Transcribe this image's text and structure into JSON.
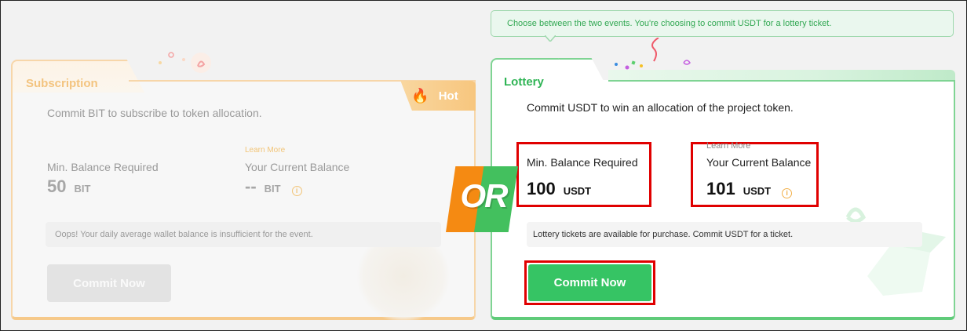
{
  "subscription": {
    "title": "Subscription",
    "badge": "Hot",
    "description": "Commit BIT to subscribe to token allocation.",
    "min_balance_label": "Min. Balance Required",
    "min_balance_value": "50",
    "min_balance_unit": "BIT",
    "learn_more": "Learn More",
    "current_balance_label": "Your Current Balance",
    "current_balance_value": "--",
    "current_balance_unit": "BIT",
    "warning": "Oops! Your daily average wallet balance is insufficient for the event.",
    "commit_label": "Commit Now"
  },
  "or_label": "OR",
  "lottery": {
    "tooltip": "Choose between the two events. You're choosing to commit USDT for a lottery ticket.",
    "title": "Lottery",
    "description": "Commit USDT to win an allocation of the project token.",
    "min_balance_label": "Min. Balance Required",
    "min_balance_value": "100",
    "min_balance_unit": "USDT",
    "learn_more": "Learn More",
    "current_balance_label": "Your Current Balance",
    "current_balance_value": "101",
    "current_balance_unit": "USDT",
    "info": "Lottery tickets are available for purchase. Commit USDT for a ticket.",
    "commit_label": "Commit Now"
  },
  "colors": {
    "subscription_accent": "#f3c47f",
    "lottery_accent": "#2fb455",
    "commit_green": "#36c464",
    "highlight_red": "#e00000",
    "or_orange": "#f58a12",
    "or_green": "#43c05e"
  },
  "icons": {
    "hot": "flame-icon",
    "info": "info-circle-icon",
    "decor_sub": "token-logo-icon",
    "decor_lot": "gift-box-icon"
  }
}
